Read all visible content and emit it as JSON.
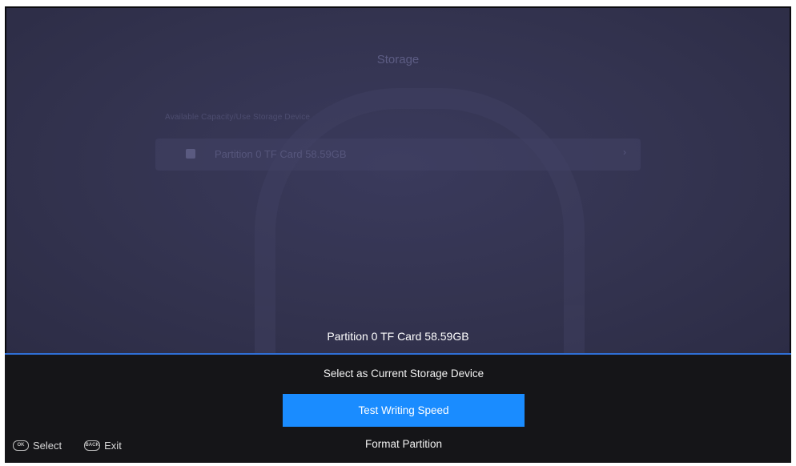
{
  "background": {
    "title": "Storage",
    "hint": "Available Capacity/Use Storage Device",
    "row_label": "Partition 0  TF Card 58.59GB",
    "row_chevron": "›"
  },
  "sheet": {
    "title": "Partition 0  TF Card  58.59GB",
    "items": [
      {
        "label": "Select as Current Storage Device",
        "selected": false
      },
      {
        "label": "Test Writing Speed",
        "selected": true
      },
      {
        "label": "Format Partition",
        "selected": false
      }
    ]
  },
  "footer": {
    "select_icon": "OK",
    "select_label": "Select",
    "exit_icon": "BACK",
    "exit_label": "Exit"
  },
  "colors": {
    "accent": "#1a8cff",
    "divider": "#2f6fd6",
    "sheet_bg": "#151518",
    "background": "#33334f"
  },
  "icons": {
    "ok_button": "ok-button-icon",
    "back_button": "back-button-icon",
    "checkbox": "checkbox-icon"
  }
}
